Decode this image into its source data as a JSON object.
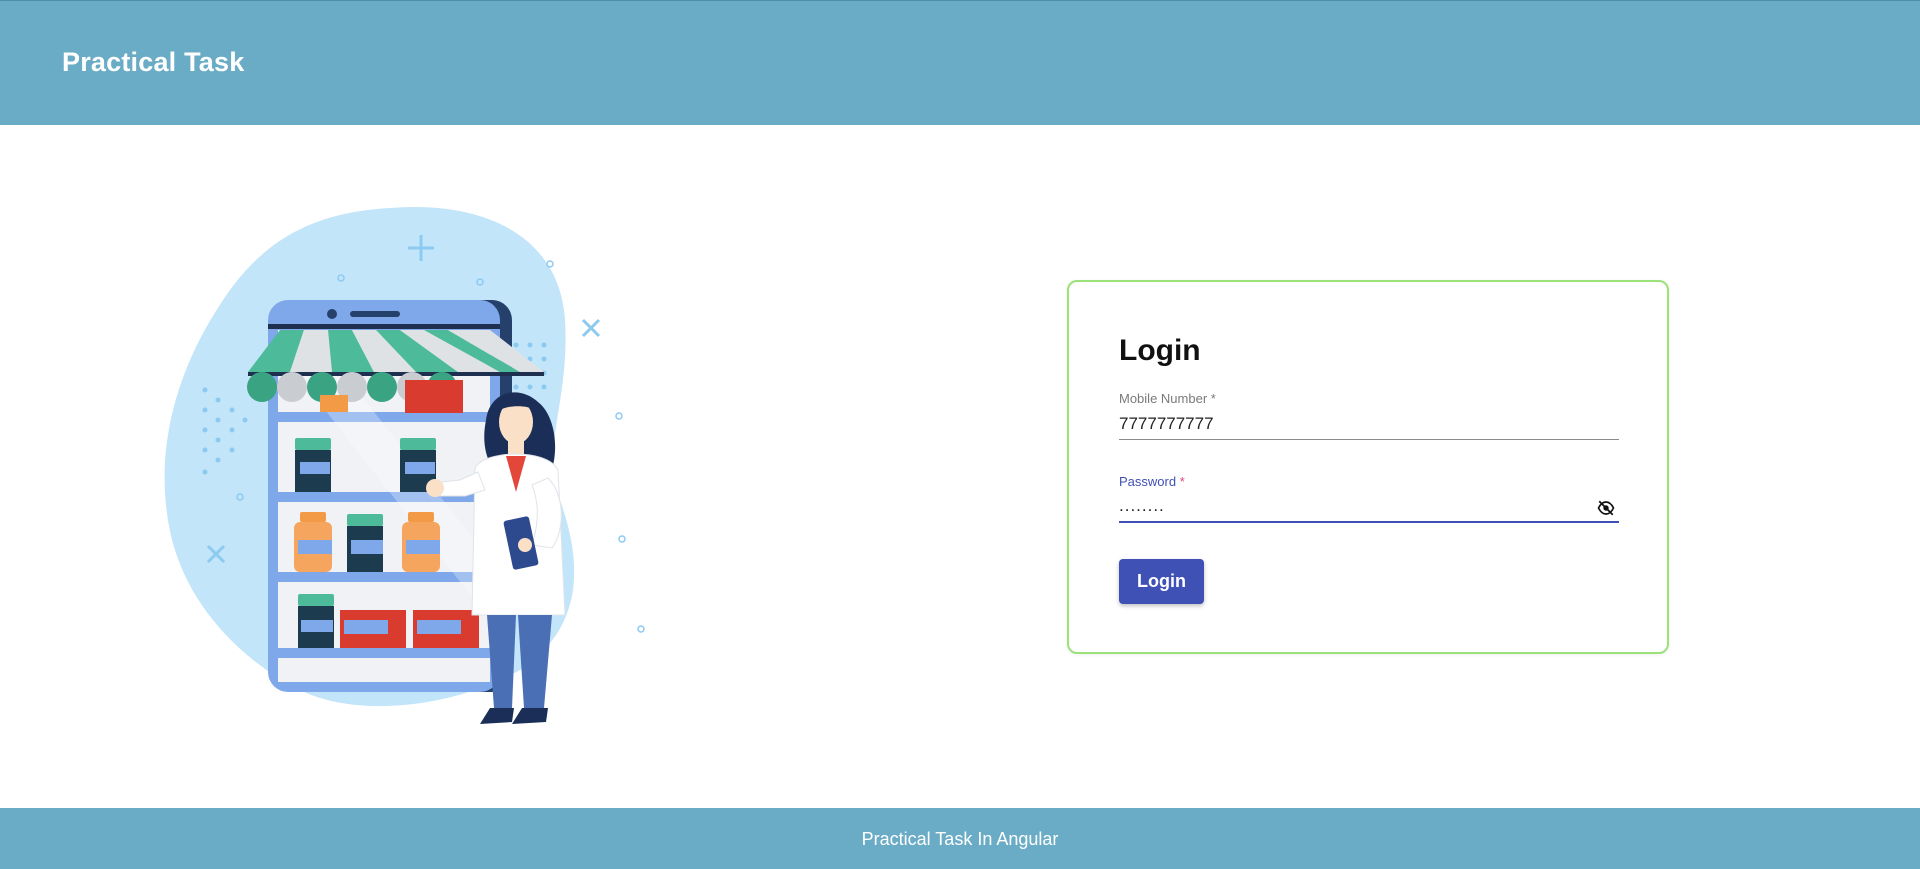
{
  "header": {
    "title": "Practical Task"
  },
  "login": {
    "title": "Login",
    "mobile": {
      "label": "Mobile Number",
      "required_mark": "*",
      "value": "7777777777"
    },
    "password": {
      "label": "Password",
      "required_mark": "*",
      "value": "........"
    },
    "button_label": "Login",
    "icons": {
      "password_toggle": "eye-off-icon"
    }
  },
  "footer": {
    "text": "Practical Task In Angular"
  },
  "colors": {
    "header_bg": "#6aacc6",
    "footer_bg": "#6aacc6",
    "primary": "#3f51b5",
    "card_border": "#9be27a",
    "required_accent": "#e0457b"
  }
}
